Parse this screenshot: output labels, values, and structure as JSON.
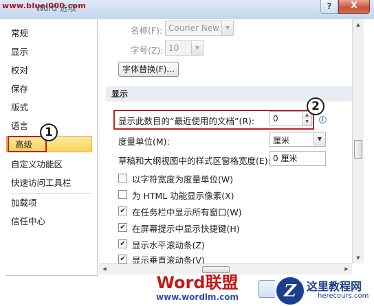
{
  "window": {
    "title": "Word 选项",
    "watermark": "www.bluei000.com",
    "help_label": "?",
    "close_label": "X"
  },
  "sidebar": {
    "items": [
      {
        "label": "常规"
      },
      {
        "label": "显示"
      },
      {
        "label": "校对"
      },
      {
        "label": "保存"
      },
      {
        "label": "版式"
      },
      {
        "label": "语言"
      },
      {
        "label": "高级",
        "selected": true
      },
      {
        "label": "自定义功能区"
      },
      {
        "label": "快速访问工具栏"
      },
      {
        "label": "加载项"
      },
      {
        "label": "信任中心"
      }
    ]
  },
  "font_section": {
    "name_label": "名称(F):",
    "name_value": "Courier New",
    "size_label": "字号(Z):",
    "size_value": "10",
    "font_sub_button": "字体替换(F)..."
  },
  "display_section": {
    "header": "显示",
    "recent_docs_label": "显示此数目的“最近使用的文档”(R):",
    "recent_docs_value": "0",
    "units_label": "度量单位(M):",
    "units_value": "厘米",
    "style_width_label": "草稿和大纲视图中的样式区窗格宽度(E):",
    "style_width_value": "0 厘米",
    "checkboxes": [
      {
        "label": "以字符宽度为度量单位(W)",
        "checked": false
      },
      {
        "label": "为 HTML 功能显示像素(X)",
        "checked": false
      },
      {
        "label": "在任务栏中显示所有窗口(W)",
        "checked": true
      },
      {
        "label": "在屏幕提示中显示快捷键(H)",
        "checked": true
      },
      {
        "label": "显示水平滚动条(Z)",
        "checked": true
      },
      {
        "label": "显示垂直滚动条(V)",
        "checked": true
      }
    ]
  },
  "annotations": {
    "callout_1": "1",
    "callout_2": "2"
  },
  "footer": {
    "logo_word": "Word",
    "logo_cn": "联盟",
    "logo_url": "www.wordlm.com",
    "corner_badge": "Z",
    "corner_name": "这里教程网",
    "corner_site": "herecours.com"
  },
  "colors": {
    "selected_bg": "#f9d458",
    "highlight_red": "#c61b2a",
    "section_bg": "#e9edf2",
    "title_bar": "#c3d6ee"
  },
  "icons": {
    "check": "check-mark-icon",
    "dropdown": "chevron-down-icon",
    "info": "info-icon",
    "spin": "spin-arrows-icon",
    "close": "close-icon",
    "help": "help-icon"
  }
}
